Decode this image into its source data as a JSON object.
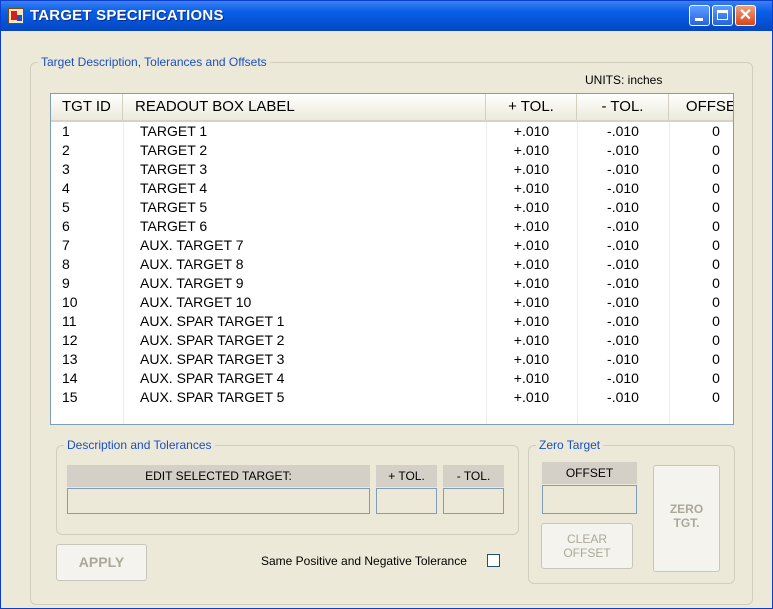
{
  "window": {
    "title": "TARGET SPECIFICATIONS",
    "controls": {
      "minimize": "minimize",
      "maximize": "maximize",
      "close": "✕"
    }
  },
  "main_group": {
    "legend": "Target Description, Tolerances and Offsets",
    "units": "UNITS: inches"
  },
  "table": {
    "columns": [
      "TGT ID",
      "READOUT BOX LABEL",
      "+ TOL.",
      "- TOL.",
      "OFFSET"
    ],
    "rows": [
      [
        "1",
        "TARGET 1",
        "+.010",
        "-.010",
        "0"
      ],
      [
        "2",
        "TARGET 2",
        "+.010",
        "-.010",
        "0"
      ],
      [
        "3",
        "TARGET 3",
        "+.010",
        "-.010",
        "0"
      ],
      [
        "4",
        "TARGET 4",
        "+.010",
        "-.010",
        "0"
      ],
      [
        "5",
        "TARGET 5",
        "+.010",
        "-.010",
        "0"
      ],
      [
        "6",
        "TARGET 6",
        "+.010",
        "-.010",
        "0"
      ],
      [
        "7",
        "AUX. TARGET 7",
        "+.010",
        "-.010",
        "0"
      ],
      [
        "8",
        "AUX. TARGET 8",
        "+.010",
        "-.010",
        "0"
      ],
      [
        "9",
        "AUX. TARGET 9",
        "+.010",
        "-.010",
        "0"
      ],
      [
        "10",
        "AUX. TARGET 10",
        "+.010",
        "-.010",
        "0"
      ],
      [
        "11",
        "AUX. SPAR TARGET 1",
        "+.010",
        "-.010",
        "0"
      ],
      [
        "12",
        "AUX. SPAR TARGET 2",
        "+.010",
        "-.010",
        "0"
      ],
      [
        "13",
        "AUX. SPAR TARGET 3",
        "+.010",
        "-.010",
        "0"
      ],
      [
        "14",
        "AUX. SPAR TARGET 4",
        "+.010",
        "-.010",
        "0"
      ],
      [
        "15",
        "AUX. SPAR TARGET 5",
        "+.010",
        "-.010",
        "0"
      ]
    ]
  },
  "description_group": {
    "legend": "Description and Tolerances",
    "edit_label": "EDIT SELECTED TARGET:",
    "plus_tol_label": "+ TOL.",
    "minus_tol_label": "- TOL.",
    "edit_value": "",
    "plus_tol_value": "",
    "minus_tol_value": ""
  },
  "zero_group": {
    "legend": "Zero Target",
    "offset_label": "OFFSET",
    "offset_value": "",
    "clear_offset_line1": "CLEAR",
    "clear_offset_line2": "OFFSET",
    "zero_tgt_line1": "ZERO",
    "zero_tgt_line2": "TGT."
  },
  "apply_button": "APPLY",
  "same_tolerance_label": "Same Positive and Negative Tolerance",
  "same_tolerance_checked": false,
  "colors": {
    "titlebar": "#0552d6",
    "legend_text": "#1b4fc1",
    "window_bg": "#ece9d8",
    "disabled_text": "#aca899"
  }
}
